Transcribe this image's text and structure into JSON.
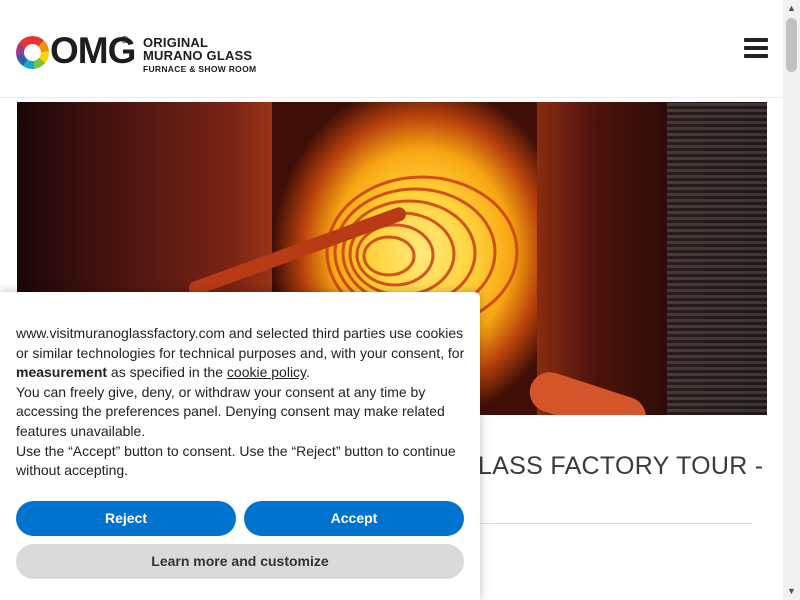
{
  "header": {
    "logo_mark": "OMG",
    "logo_reg": "®",
    "brand_line1": "ORIGINAL",
    "brand_line2": "MURANO GLASS",
    "brand_line3": "FURNACE & SHOW ROOM",
    "menu_icon": "hamburger-menu-icon"
  },
  "hero": {
    "image_desc": "glass-furnace-image"
  },
  "content": {
    "heading_visible": "LASS FACTORY TOUR -"
  },
  "cookie_banner": {
    "p1_start": "www.visitmuranoglassfactory.com and selected third parties use cookies or similar technologies for technical purposes and, with your consent, for ",
    "p1_bold": "measurement",
    "p1_mid": " as specified in the ",
    "p1_link": "cookie policy",
    "p1_end": ".",
    "p2": "You can freely give, deny, or withdraw your consent at any time by accessing the preferences panel. Denying consent may make related features unavailable.",
    "p3": "Use the “Accept” button to consent. Use the “Reject” button to continue without accepting.",
    "reject_label": "Reject",
    "accept_label": "Accept",
    "learn_label": "Learn more and customize"
  },
  "colors": {
    "button_blue": "#0073ce",
    "button_grey": "#dadada",
    "text_dark": "#222222"
  }
}
